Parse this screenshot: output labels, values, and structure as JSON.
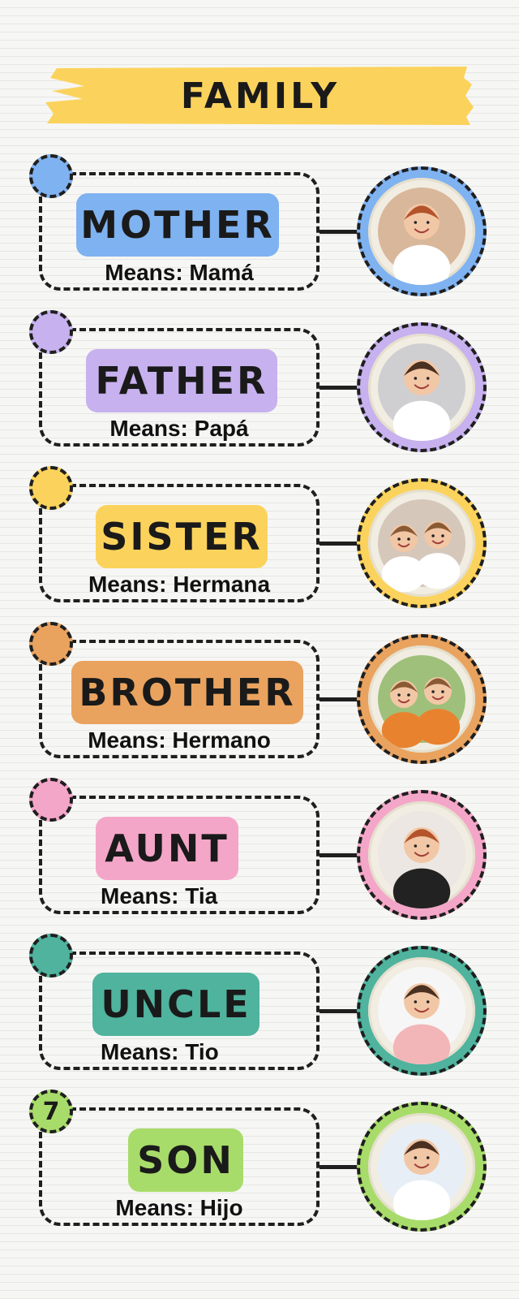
{
  "title": "FAMILY",
  "banner_color": "#fbd35c",
  "entries": [
    {
      "word": "MOTHER",
      "means": "Means: Mamá",
      "color": "#7fb2f0",
      "dot_label": "",
      "photo_icon": "mother-photo-icon",
      "scene": "#d9b79a"
    },
    {
      "word": "FATHER",
      "means": "Means: Papá",
      "color": "#c7b1ee",
      "dot_label": "",
      "photo_icon": "father-photo-icon",
      "scene": "#cfcfd2"
    },
    {
      "word": "SISTER",
      "means": "Means: Hermana",
      "color": "#fbd35c",
      "dot_label": "",
      "photo_icon": "sisters-photo-icon",
      "scene": "#d5c8bb"
    },
    {
      "word": "BROTHER",
      "means": "Means: Hermano",
      "color": "#e9a35f",
      "dot_label": "",
      "photo_icon": "brothers-photo-icon",
      "scene": "#9ec07a"
    },
    {
      "word": "AUNT",
      "means": "Means: Tia",
      "color": "#f4a6c8",
      "dot_label": "",
      "photo_icon": "aunt-photo-icon",
      "scene": "#ece7e2"
    },
    {
      "word": "UNCLE",
      "means": "Means: Tio",
      "color": "#4fb39e",
      "dot_label": "",
      "photo_icon": "uncle-photo-icon",
      "scene": "#f6f6f6"
    },
    {
      "word": "SON",
      "means": "Means: Hijo",
      "color": "#a8dc6a",
      "dot_label": "7",
      "photo_icon": "son-photo-icon",
      "scene": "#e7eef5"
    }
  ]
}
